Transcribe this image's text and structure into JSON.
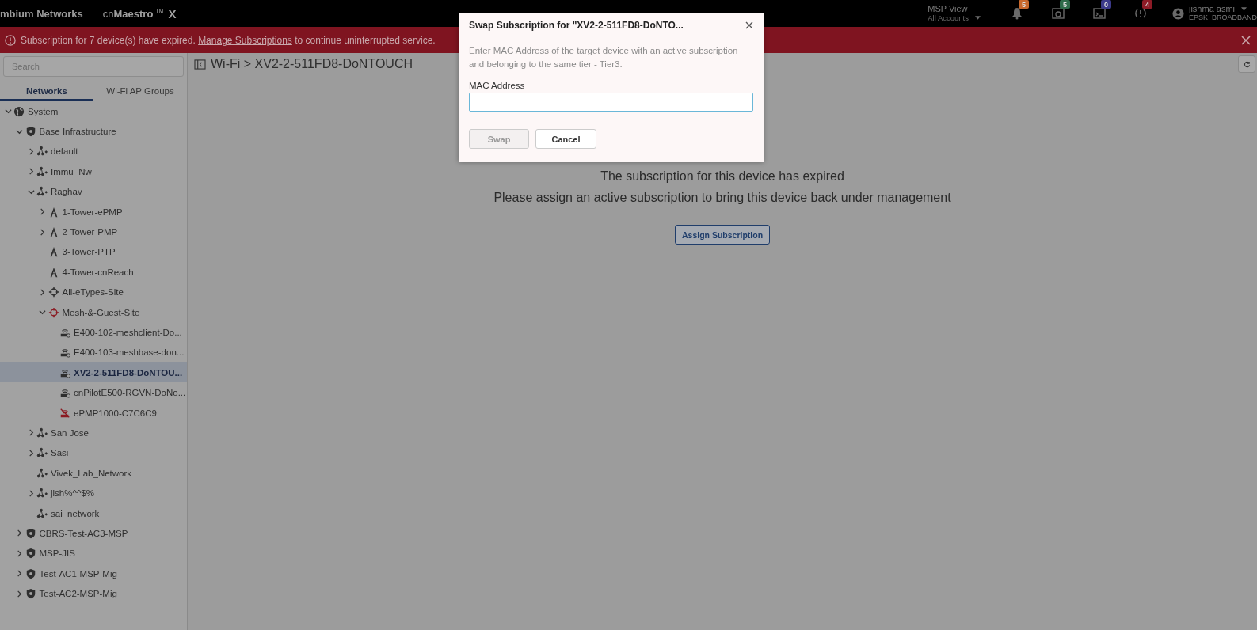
{
  "header": {
    "brand": "mbium Networks",
    "product": "cn**Maestro**$^{TM}$",
    "product_suffix": "X",
    "view": {
      "title": "MSP View",
      "subtitle": "All Accounts"
    },
    "notifications": [
      {
        "kind": "bell",
        "count": "5",
        "color": "#c8682c"
      },
      {
        "kind": "window",
        "count": "5",
        "color": "#2e6b4a"
      },
      {
        "kind": "terminal",
        "count": "0",
        "color": "#3c3a8a"
      },
      {
        "kind": "alert",
        "count": "4",
        "color": "#8e1b26"
      }
    ],
    "user": {
      "name": "jishma asmi",
      "org": "EPSK_BROADBAND"
    }
  },
  "banner": {
    "before": "Subscription for 7 device(s) have expired.",
    "link": "Manage Subscriptions",
    "after": "to continue uninterrupted service."
  },
  "sidebar": {
    "search": {
      "placeholder": "Search"
    },
    "tabs": [
      {
        "label": "Networks",
        "selected": true
      },
      {
        "label": "Wi-Fi AP Groups",
        "selected": false
      }
    ],
    "tree": [
      {
        "label": "System",
        "kind": "globe",
        "expanded": true,
        "selected": false,
        "children": [
          {
            "label": "Base Infrastructure",
            "kind": "shield",
            "expanded": true,
            "selected": false,
            "children": [
              {
                "label": "default",
                "kind": "network",
                "expanded": false,
                "selected": false
              },
              {
                "label": "Immu_Nw",
                "kind": "network",
                "expanded": false,
                "selected": false
              },
              {
                "label": "Raghav",
                "kind": "network",
                "expanded": true,
                "selected": false,
                "children": [
                  {
                    "label": "1-Tower-ePMP",
                    "kind": "tower",
                    "expanded": false,
                    "selected": false
                  },
                  {
                    "label": "2-Tower-PMP",
                    "kind": "tower",
                    "expanded": false,
                    "selected": false
                  },
                  {
                    "label": "3-Tower-PTP",
                    "kind": "tower",
                    "selected": false
                  },
                  {
                    "label": "4-Tower-cnReach",
                    "kind": "tower",
                    "selected": false
                  },
                  {
                    "label": "All-eTypes-Site",
                    "kind": "site",
                    "expanded": false,
                    "selected": false
                  },
                  {
                    "label": "Mesh-&-Guest-Site",
                    "kind": "site-alert",
                    "expanded": true,
                    "selected": false,
                    "children": [
                      {
                        "label": "E400-102-meshclient-Do...",
                        "kind": "device",
                        "selected": false
                      },
                      {
                        "label": "E400-103-meshbase-don...",
                        "kind": "device",
                        "selected": false
                      },
                      {
                        "label": "XV2-2-511FD8-DoNTOU...",
                        "kind": "device",
                        "selected": true
                      },
                      {
                        "label": "cnPilotE500-RGVN-DoNo...",
                        "kind": "device",
                        "selected": false
                      },
                      {
                        "label": "ePMP1000-C7C6C9",
                        "kind": "device-down",
                        "selected": false
                      }
                    ]
                  }
                ]
              },
              {
                "label": "San Jose",
                "kind": "network",
                "expanded": false,
                "selected": false
              },
              {
                "label": "Sasi",
                "kind": "network",
                "expanded": false,
                "selected": false
              },
              {
                "label": "Vivek_Lab_Network",
                "kind": "network",
                "selected": false
              },
              {
                "label": "jish%^^$%",
                "kind": "network",
                "expanded": false,
                "selected": false
              },
              {
                "label": "sai_network",
                "kind": "network",
                "selected": false
              }
            ]
          },
          {
            "label": "CBRS-Test-AC3-MSP",
            "kind": "shield",
            "expanded": false,
            "selected": false
          },
          {
            "label": "MSP-JIS",
            "kind": "shield",
            "expanded": false,
            "selected": false
          },
          {
            "label": "Test-AC1-MSP-Mig",
            "kind": "shield",
            "expanded": false,
            "selected": false
          },
          {
            "label": "Test-AC2-MSP-Mig",
            "kind": "shield",
            "expanded": false,
            "selected": false
          }
        ]
      }
    ]
  },
  "breadcrumb": "Wi-Fi > XV2-2-511FD8-DoNTOUCH",
  "main": {
    "messages": [
      "The subscription for this device has expired",
      "Please assign an active subscription to bring this device back under management"
    ],
    "button": "Assign Subscription"
  },
  "dialog": {
    "title": "Swap Subscription for \"XV2-2-511FD8-DoNTO...",
    "description": "Enter MAC Address of the target device with an active subscription and belonging to the same tier - Tier3.",
    "field_label": "MAC Address",
    "buttons": [
      {
        "label": "Swap",
        "disabled": true
      },
      {
        "label": "Cancel",
        "disabled": false
      }
    ]
  }
}
